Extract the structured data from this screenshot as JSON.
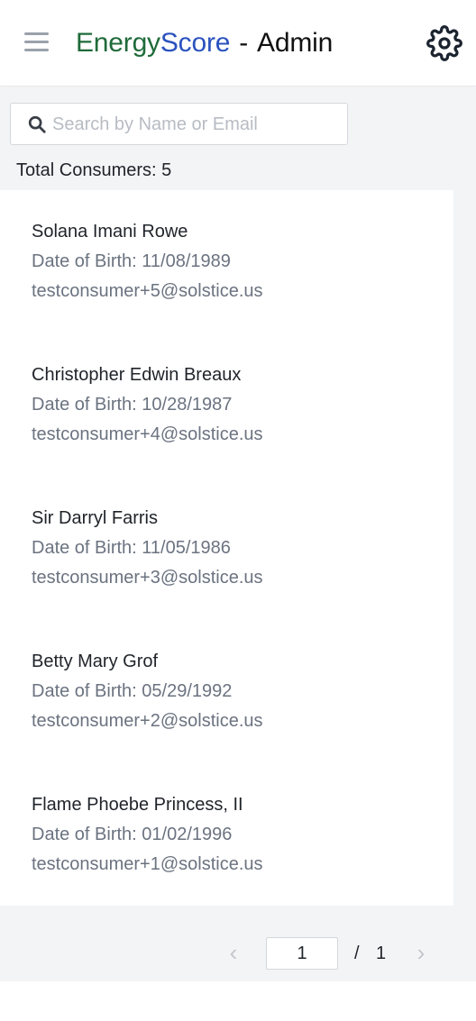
{
  "header": {
    "brand_part1": "Energy",
    "brand_part2": "Score",
    "separator": "-",
    "section": "Admin",
    "menu_icon": "hamburger-menu-icon",
    "settings_icon": "gear-icon"
  },
  "search": {
    "placeholder": "Search by Name or Email",
    "value": "",
    "icon": "search-icon"
  },
  "summary": {
    "total_label": "Total Consumers: 5"
  },
  "consumers": [
    {
      "name": "Solana Imani Rowe",
      "dob": "Date of Birth: 11/08/1989",
      "email": "testconsumer+5@solstice.us"
    },
    {
      "name": "Christopher Edwin Breaux",
      "dob": "Date of Birth: 10/28/1987",
      "email": "testconsumer+4@solstice.us"
    },
    {
      "name": "Sir Darryl Farris",
      "dob": "Date of Birth: 11/05/1986",
      "email": "testconsumer+3@solstice.us"
    },
    {
      "name": "Betty Mary Grof",
      "dob": "Date of Birth: 05/29/1992",
      "email": "testconsumer+2@solstice.us"
    },
    {
      "name": "Flame Phoebe Princess, II",
      "dob": "Date of Birth: 01/02/1996",
      "email": "testconsumer+1@solstice.us"
    }
  ],
  "pagination": {
    "current_page": "1",
    "separator": "/",
    "total_pages": "1",
    "prev_glyph": "‹",
    "next_glyph": "›"
  },
  "colors": {
    "brand_green": "#1f6b3a",
    "brand_blue": "#2a52be",
    "muted_text": "#6b7380",
    "page_background": "#f3f4f6"
  }
}
